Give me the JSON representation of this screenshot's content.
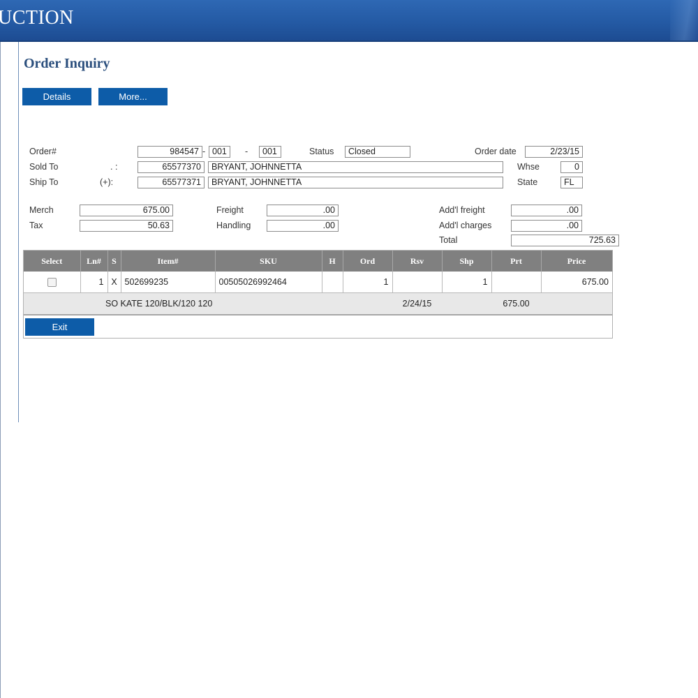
{
  "banner": {
    "title": "UCTION"
  },
  "page_title": "Order Inquiry",
  "buttons": {
    "details": "Details",
    "more": "More...",
    "exit": "Exit"
  },
  "header": {
    "order_label": "Order#",
    "order_no": "984547",
    "order_dash": "-",
    "order_seq1": "001",
    "order_sep": "-",
    "order_seq2": "001",
    "status_label": "Status",
    "status_value": "Closed",
    "order_date_label": "Order date",
    "order_date_value": "2/23/15",
    "sold_to_label": "Sold To",
    "sold_to_marker": ". :",
    "sold_to_no": "65577370",
    "sold_to_name": "BRYANT, JOHNNETTA",
    "whse_label": "Whse",
    "whse_value": "0",
    "ship_to_label": "Ship To",
    "ship_to_marker": "(+):",
    "ship_to_no": "65577371",
    "ship_to_name": "BRYANT, JOHNNETTA",
    "state_label": "State",
    "state_value": "FL"
  },
  "totals": {
    "merch_label": "Merch",
    "merch_value": "675.00",
    "tax_label": "Tax",
    "tax_value": "50.63",
    "freight_label": "Freight",
    "freight_value": ".00",
    "handling_label": "Handling",
    "handling_value": ".00",
    "addl_freight_label": "Add'l freight",
    "addl_freight_value": ".00",
    "addl_charges_label": "Add'l charges",
    "addl_charges_value": ".00",
    "total_label": "Total",
    "total_value": "725.63"
  },
  "lines": {
    "columns": [
      "Select",
      "Ln#",
      "S",
      "Item#",
      "SKU",
      "H",
      "Ord",
      "Rsv",
      "Shp",
      "Prt",
      "Price"
    ],
    "rows": [
      {
        "ln": "1",
        "s": "X",
        "item": "502699235",
        "sku": "00505026992464",
        "h": "",
        "ord": "1",
        "rsv": "",
        "shp": "1",
        "prt": "",
        "price": "675.00",
        "description": "SO KATE 120/BLK/120  120",
        "date": "2/24/15",
        "amount": "675.00"
      }
    ]
  }
}
